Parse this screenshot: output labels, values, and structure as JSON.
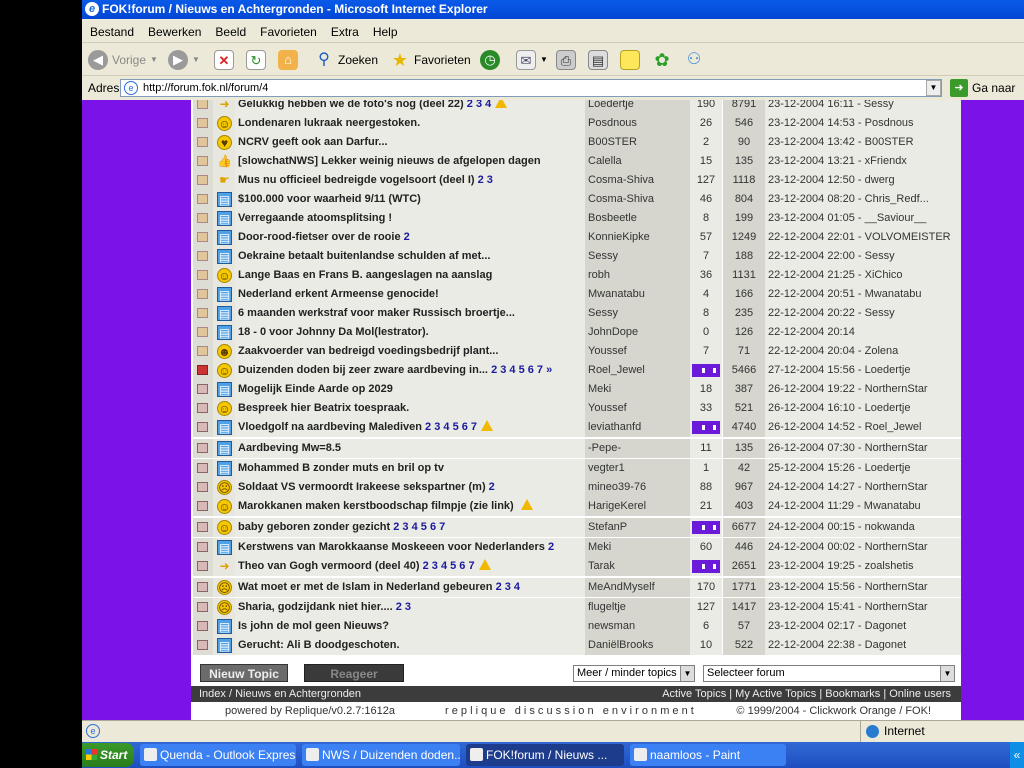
{
  "window": {
    "title": "FOK!forum / Nieuws en Achtergronden - Microsoft Internet Explorer"
  },
  "menu": [
    "Bestand",
    "Bewerken",
    "Beeld",
    "Favorieten",
    "Extra",
    "Help"
  ],
  "toolbar": {
    "back": "Vorige",
    "search": "Zoeken",
    "favorites": "Favorieten"
  },
  "address": {
    "label": "Adres",
    "url": "http://forum.fok.nl/forum/4",
    "go": "Ga naar"
  },
  "topics": [
    {
      "status": "normal",
      "icon": "arrow",
      "title": "Gelukkig hebben we de foto's nog (deel 22)",
      "pages": "2 3 4",
      "warn": true,
      "author": "Loedertje",
      "replies": "190",
      "views": "8791",
      "last": "23-12-2004 16:11 - Sessy"
    },
    {
      "status": "normal",
      "icon": "smile",
      "title": "Londenaren lukraak neergestoken.",
      "pages": "",
      "warn": false,
      "author": "Posdnous",
      "replies": "26",
      "views": "546",
      "last": "23-12-2004 14:53 - Posdnous"
    },
    {
      "status": "normal",
      "icon": "heart",
      "title": "NCRV geeft ook aan Darfur...",
      "pages": "",
      "warn": false,
      "author": "B00STER",
      "replies": "2",
      "views": "90",
      "last": "23-12-2004 13:42 - B00STER"
    },
    {
      "status": "normal",
      "icon": "thumb",
      "title": "[slowchatNWS] Lekker weinig nieuws de afgelopen dagen",
      "pages": "",
      "warn": false,
      "author": "Calella",
      "replies": "15",
      "views": "135",
      "last": "23-12-2004 13:21 - xFriendx"
    },
    {
      "status": "normal",
      "icon": "hand",
      "title": "Mus nu officieel bedreigde vogelsoort (deel I)",
      "pages": "2 3",
      "warn": false,
      "author": "Cosma-Shiva",
      "replies": "127",
      "views": "1118",
      "last": "23-12-2004 12:50 - dwerg"
    },
    {
      "status": "normal",
      "icon": "doc",
      "title": "$100.000 voor waarheid 9/11 (WTC)",
      "pages": "",
      "warn": false,
      "author": "Cosma-Shiva",
      "replies": "46",
      "views": "804",
      "last": "23-12-2004 08:20 - Chris_Redf..."
    },
    {
      "status": "normal",
      "icon": "doc",
      "title": "Verregaande atoomsplitsing !",
      "pages": "",
      "warn": false,
      "author": "Bosbeetle",
      "replies": "8",
      "views": "199",
      "last": "23-12-2004 01:05 - __Saviour__"
    },
    {
      "status": "normal",
      "icon": "doc",
      "title": "Door-rood-fietser over de rooie",
      "pages": "2",
      "warn": false,
      "author": "KonnieKipke",
      "replies": "57",
      "views": "1249",
      "last": "22-12-2004 22:01 - VOLVOMEISTER"
    },
    {
      "status": "normal",
      "icon": "doc",
      "title": "Oekraine betaalt buitenlandse schulden af met...",
      "pages": "",
      "warn": false,
      "author": "Sessy",
      "replies": "7",
      "views": "188",
      "last": "22-12-2004 22:00 - Sessy"
    },
    {
      "status": "normal",
      "icon": "smile",
      "title": "Lange Baas en Frans B. aangeslagen na aanslag",
      "pages": "",
      "warn": false,
      "author": "robh",
      "replies": "36",
      "views": "1131",
      "last": "22-12-2004 21:25 - XiChico"
    },
    {
      "status": "normal",
      "icon": "doc",
      "title": "Nederland erkent Armeense genocide!",
      "pages": "",
      "warn": false,
      "author": "Mwanatabu",
      "replies": "4",
      "views": "166",
      "last": "22-12-2004 20:51 - Mwanatabu"
    },
    {
      "status": "normal",
      "icon": "doc",
      "title": "6 maanden werkstraf voor maker Russisch broertje...",
      "pages": "",
      "warn": false,
      "author": "Sessy",
      "replies": "8",
      "views": "235",
      "last": "22-12-2004 20:22 - Sessy"
    },
    {
      "status": "normal",
      "icon": "doc",
      "title": "18 - 0 voor Johnny Da Mol(lestrator).",
      "pages": "",
      "warn": false,
      "author": "JohnDope",
      "replies": "0",
      "views": "126",
      "last": "22-12-2004 20:14"
    },
    {
      "status": "normal",
      "icon": "cool",
      "title": "Zaakvoerder van bedreigd voedingsbedrijf plant...",
      "pages": "",
      "warn": false,
      "author": "Youssef",
      "replies": "7",
      "views": "71",
      "last": "22-12-2004 20:04 - Zolena"
    },
    {
      "status": "hot",
      "icon": "smile",
      "title": "Duizenden doden bij zeer zware aardbeving in...",
      "pages": "2 3 4 5 6 7 »",
      "warn": false,
      "author": "Roel_Jewel",
      "replies": "",
      "views": "5466",
      "last": "27-12-2004 15:56 - Loedertje"
    },
    {
      "status": "lock",
      "icon": "doc",
      "title": "Mogelijk Einde Aarde op 2029",
      "pages": "",
      "warn": false,
      "author": "Meki",
      "replies": "18",
      "views": "387",
      "last": "26-12-2004 19:22 - NorthernStar"
    },
    {
      "status": "lock",
      "icon": "smile",
      "title": "Bespreek hier Beatrix toespraak.",
      "pages": "",
      "warn": false,
      "author": "Youssef",
      "replies": "33",
      "views": "521",
      "last": "26-12-2004 16:10 - Loedertje"
    },
    {
      "status": "lock",
      "icon": "doc",
      "title": "Vloedgolf na aardbeving Malediven",
      "pages": "2 3 4 5 6 7",
      "warn": true,
      "author": "leviathanfd",
      "replies": "",
      "views": "4740",
      "last": "26-12-2004 14:52 - Roel_Jewel"
    },
    {
      "status": "lock",
      "icon": "doc",
      "title": "Aardbeving Mw=8.5",
      "pages": "",
      "warn": false,
      "author": "-Pepe-",
      "replies": "11",
      "views": "135",
      "last": "26-12-2004 07:30 - NorthernStar"
    },
    {
      "status": "lock",
      "icon": "doc",
      "title": "Mohammed B zonder muts en bril op tv",
      "pages": "",
      "warn": false,
      "author": "vegter1",
      "replies": "1",
      "views": "42",
      "last": "25-12-2004 15:26 - Loedertje"
    },
    {
      "status": "lock",
      "icon": "shock",
      "title": "Soldaat VS vermoordt Irakeese sekspartner (m)",
      "pages": "2",
      "warn": false,
      "author": "mineo39-76",
      "replies": "88",
      "views": "967",
      "last": "24-12-2004 14:27 - NorthernStar"
    },
    {
      "status": "lock",
      "icon": "smile",
      "title": "Marokkanen maken kerstboodschap filmpje (zie link)",
      "pages": "",
      "warn": true,
      "author": "HarigeKerel",
      "replies": "21",
      "views": "403",
      "last": "24-12-2004 11:29 - Mwanatabu"
    },
    {
      "status": "lock",
      "icon": "grin",
      "title": "baby geboren zonder gezicht",
      "pages": "2 3 4 5 6 7",
      "warn": false,
      "author": "StefanP",
      "replies": "",
      "views": "6677",
      "last": "24-12-2004 00:15 - nokwanda"
    },
    {
      "status": "lock",
      "icon": "doc",
      "title": "Kerstwens van Marokkaanse Moskeeen voor Nederlanders",
      "pages": "2",
      "warn": false,
      "author": "Meki",
      "replies": "60",
      "views": "446",
      "last": "24-12-2004 00:02 - NorthernStar"
    },
    {
      "status": "lock",
      "icon": "arrow",
      "title": "Theo van Gogh vermoord (deel 40)",
      "pages": "2 3 4 5 6 7",
      "warn": true,
      "author": "Tarak",
      "replies": "",
      "views": "2651",
      "last": "23-12-2004 19:25 - zoalshetis"
    },
    {
      "status": "lock",
      "icon": "confused",
      "title": "Wat moet er met de Islam in Nederland gebeuren",
      "pages": "2 3 4",
      "warn": false,
      "author": "MeAndMyself",
      "replies": "170",
      "views": "1771",
      "last": "23-12-2004 15:56 - NorthernStar"
    },
    {
      "status": "lock",
      "icon": "sad",
      "title": "Sharia, godzijdank niet hier....",
      "pages": "2 3",
      "warn": false,
      "author": "flugeltje",
      "replies": "127",
      "views": "1417",
      "last": "23-12-2004 15:41 - NorthernStar"
    },
    {
      "status": "lock",
      "icon": "doc",
      "title": "Is john de mol geen Nieuws?",
      "pages": "",
      "warn": false,
      "author": "newsman",
      "replies": "6",
      "views": "57",
      "last": "23-12-2004 02:17 - Dagonet"
    },
    {
      "status": "lock",
      "icon": "doc",
      "title": "Gerucht: Ali B doodgeschoten.",
      "pages": "",
      "warn": false,
      "author": "DaniëlBrooks",
      "replies": "10",
      "views": "522",
      "last": "22-12-2004 22:38 - Dagonet"
    }
  ],
  "actions": {
    "new_topic": "Nieuw Topic",
    "reply": "Reageer",
    "topics_select": "Meer / minder topics",
    "forum_select": "Selecteer forum"
  },
  "nav": {
    "breadcrumb": "Index / Nieuws en Achtergronden",
    "links": "Active Topics | My Active Topics | Bookmarks | Online users"
  },
  "footer": {
    "powered": "powered by Replique/v0.2.7:1612a",
    "tagline": "r e p l i q u e   d i s c u s s i o n   e n v i r o n m e n t",
    "copyright": "© 1999/2004 - Clickwork Orange / FOK!"
  },
  "status": {
    "zone": "Internet"
  },
  "taskbar": {
    "start": "Start",
    "tasks": [
      "Quenda - Outlook Express",
      "NWS / Duizenden doden...",
      "FOK!forum / Nieuws ...",
      "naamloos - Paint"
    ],
    "tray": "«"
  }
}
